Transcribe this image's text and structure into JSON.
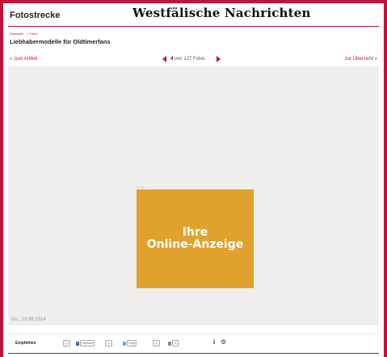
{
  "header": {
    "section_title": "Fotostrecke",
    "brand": "Westfälische Nachrichten"
  },
  "breadcrumb": [
    "Startseite",
    "> Fotos"
  ],
  "gallery": {
    "title": "Liebhabermodelle für Oldtimerfans",
    "back_link": "« zum Artikel",
    "overview_link": "zur Übersicht  »",
    "current": "4",
    "counter_rest": "von 127 Fotos"
  },
  "ad": {
    "caption": "Anzeige",
    "text": "Ihre\nOnline-Anzeige"
  },
  "photo": {
    "date": "Do., 23.08.2014"
  },
  "toolbar": {
    "recommend_label": "Empfehlen",
    "facebook_label": "Facebook",
    "tweet_label": "Tweet",
    "info_icon": "i",
    "gear_icon": "⚙"
  },
  "colors": {
    "accent": "#c5103a",
    "ad_background": "#e0a12e",
    "stage_background": "#efeeec"
  }
}
